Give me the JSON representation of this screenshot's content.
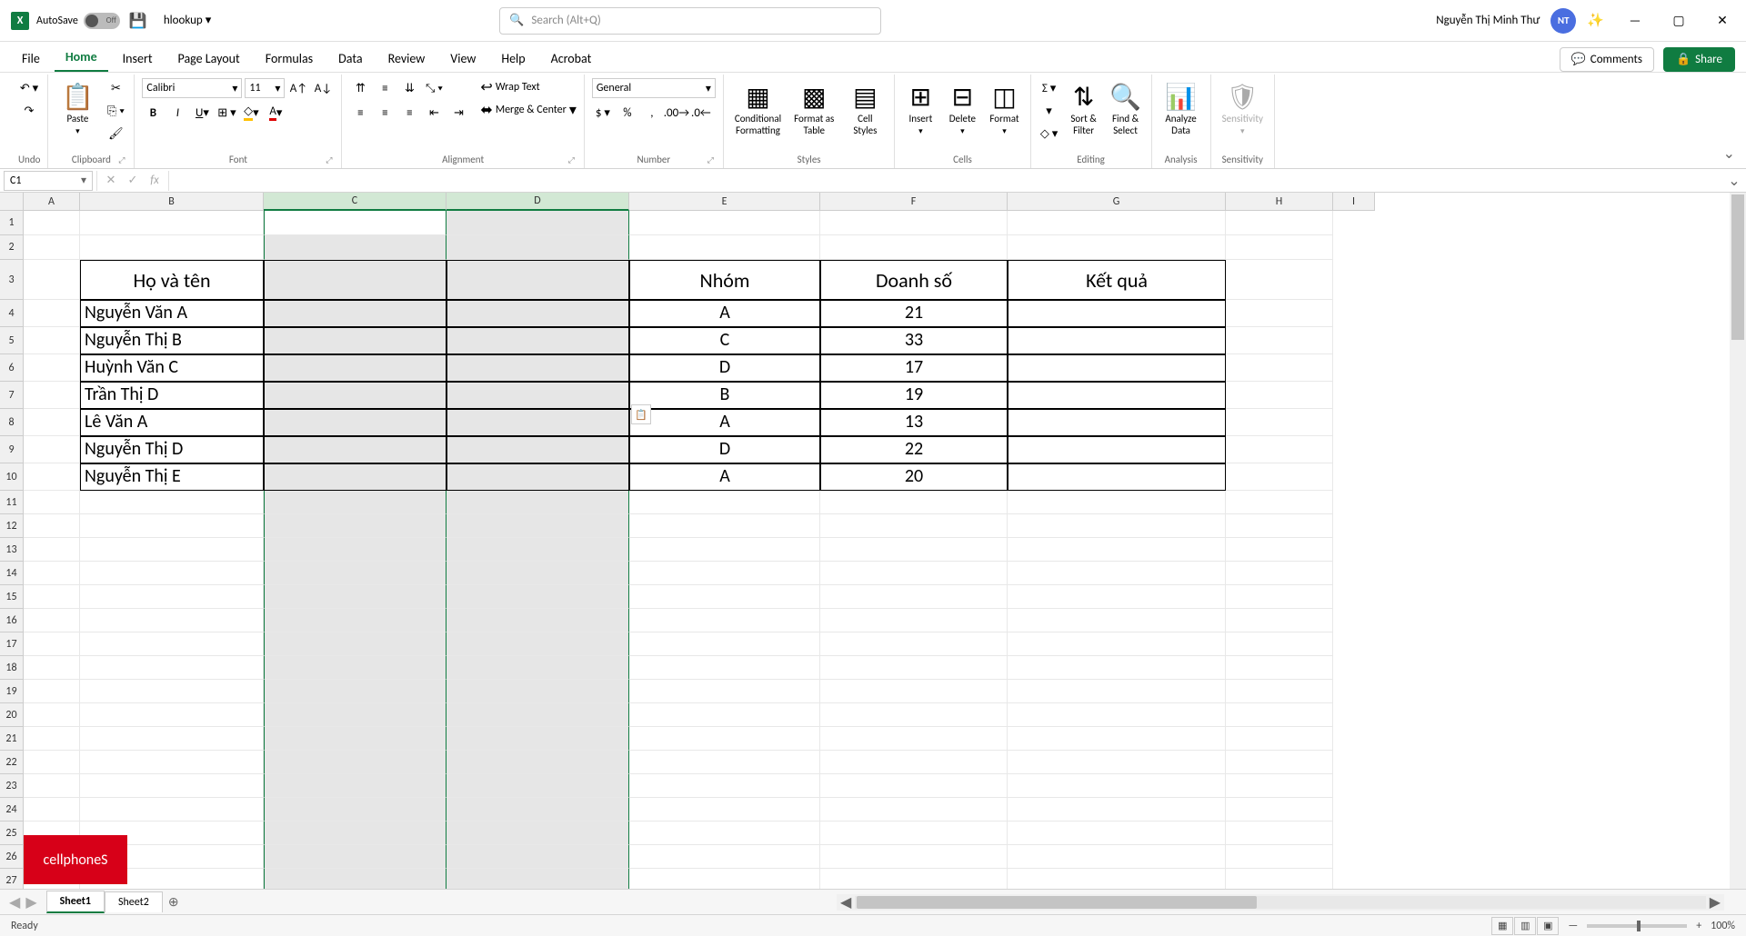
{
  "titlebar": {
    "autosave_label": "AutoSave",
    "autosave_state": "Off",
    "filename": "hlookup",
    "search_placeholder": "Search (Alt+Q)",
    "user_name": "Nguyễn Thị Minh Thư",
    "user_initials": "NT"
  },
  "menu": {
    "tabs": [
      "File",
      "Home",
      "Insert",
      "Page Layout",
      "Formulas",
      "Data",
      "Review",
      "View",
      "Help",
      "Acrobat"
    ],
    "active": 1,
    "comments": "Comments",
    "share": "Share"
  },
  "ribbon": {
    "undo": {
      "label": "Undo"
    },
    "clipboard": {
      "label": "Clipboard",
      "paste": "Paste"
    },
    "font": {
      "label": "Font",
      "name": "Calibri",
      "size": "11"
    },
    "alignment": {
      "label": "Alignment",
      "wrap": "Wrap Text",
      "merge": "Merge & Center"
    },
    "number": {
      "label": "Number",
      "format": "General"
    },
    "styles": {
      "label": "Styles",
      "cond": "Conditional\nFormatting",
      "table": "Format as\nTable",
      "cell": "Cell\nStyles"
    },
    "cells": {
      "label": "Cells",
      "insert": "Insert",
      "delete": "Delete",
      "format": "Format"
    },
    "editing": {
      "label": "Editing",
      "sort": "Sort &\nFilter",
      "find": "Find &\nSelect"
    },
    "analysis": {
      "label": "Analysis",
      "analyze": "Analyze\nData"
    },
    "sensitivity": {
      "label": "Sensitivity",
      "btn": "Sensitivity"
    }
  },
  "formula_bar": {
    "cell_ref": "C1",
    "formula": ""
  },
  "columns": [
    "A",
    "B",
    "C",
    "D",
    "E",
    "F",
    "G",
    "H",
    "I"
  ],
  "row_heights": {
    "r1": 27,
    "r2": 27,
    "r3": 42,
    "r4": 30,
    "r5": 30,
    "r6": 30,
    "r7": 30,
    "r8": 30,
    "r9": 30,
    "r10": 30
  },
  "table": {
    "headers": {
      "b": "Họ và tên",
      "e": "Nhóm",
      "f": "Doanh số",
      "g": "Kết quả"
    },
    "rows": [
      {
        "b": "Nguyễn Văn A",
        "e": "A",
        "f": "21"
      },
      {
        "b": "Nguyễn Thị B",
        "e": "C",
        "f": "33"
      },
      {
        "b": "Huỳnh Văn C",
        "e": "D",
        "f": "17"
      },
      {
        "b": "Trần Thị D",
        "e": "B",
        "f": "19"
      },
      {
        "b": "Lê Văn A",
        "e": "A",
        "f": "13"
      },
      {
        "b": "Nguyễn Thị D",
        "e": "D",
        "f": "22"
      },
      {
        "b": "Nguyễn Thị E",
        "e": "A",
        "f": "20"
      }
    ]
  },
  "tabs": {
    "sheets": [
      "Sheet1",
      "Sheet2"
    ],
    "active": 0
  },
  "status": {
    "ready": "Ready",
    "zoom": "100%"
  },
  "watermark": "cellphoneS"
}
